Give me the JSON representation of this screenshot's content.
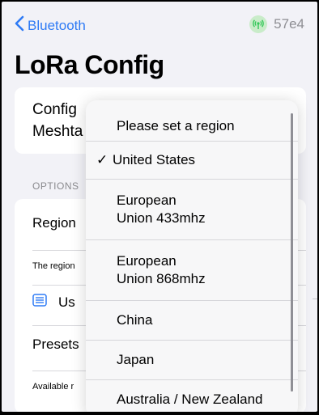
{
  "nav": {
    "back_label": "Bluetooth",
    "device_id": "57e4"
  },
  "page_title": "LoRa Config",
  "top_card": {
    "text": "Config\nMeshta"
  },
  "options": {
    "header": "OPTIONS",
    "region_label": "Region",
    "region_desc": "The region",
    "use_label": "Us",
    "presets_label": "Presets",
    "available_desc": "Available r"
  },
  "region_menu": {
    "items": [
      {
        "label": "Please set a region",
        "selected": false
      },
      {
        "label": "United States",
        "selected": true
      },
      {
        "label": "European\nUnion 433mhz",
        "selected": false
      },
      {
        "label": "European\nUnion 868mhz",
        "selected": false
      },
      {
        "label": "China",
        "selected": false
      },
      {
        "label": "Japan",
        "selected": false
      },
      {
        "label": "Australia / New Zealand",
        "selected": false
      }
    ],
    "check_glyph": "✓"
  },
  "colors": {
    "accent": "#2f7bf5",
    "status_green": "#34c759",
    "background": "#f2f2f7"
  },
  "icons": {
    "back": "chevron-left-icon",
    "status": "antenna-icon",
    "use": "list-icon",
    "check": "checkmark-icon"
  }
}
